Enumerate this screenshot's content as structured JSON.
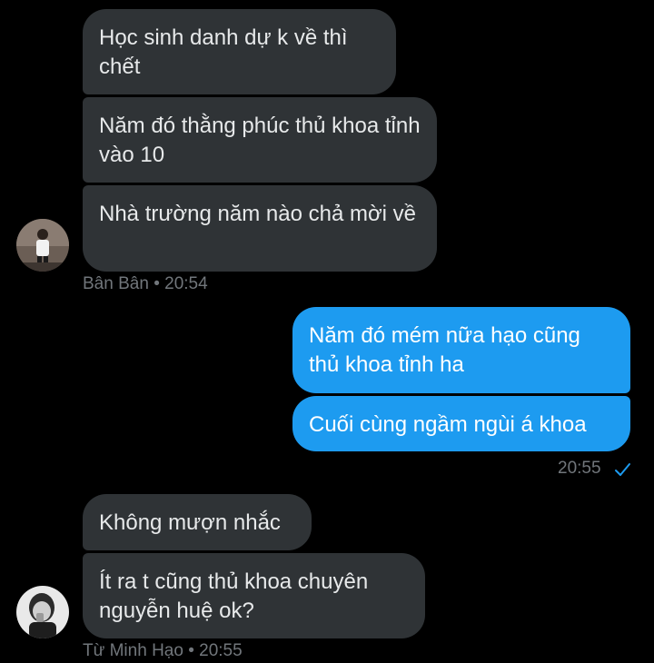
{
  "conversation": {
    "group1": {
      "messages": [
        "Học sinh danh dự k về thì chết",
        "Năm đó thằng phúc thủ khoa tỉnh vào 10",
        "Nhà trường năm nào chả mời về"
      ],
      "sender": "Bân Bân",
      "time": "20:54",
      "avatar_icon": "person-avatar-icon"
    },
    "group2": {
      "messages": [
        "Năm đó mém nữa hạo cũng thủ khoa tỉnh ha",
        "Cuối cùng ngầm ngùi á khoa"
      ],
      "time": "20:55",
      "status_icon": "check-icon"
    },
    "group3": {
      "messages": [
        "Không mượn nhắc",
        "Ít ra t cũng thủ khoa chuyên nguyễn huệ ok?"
      ],
      "sender": "Từ Minh Hạo",
      "time": "20:55",
      "avatar_icon": "person-avatar-icon"
    },
    "separator": "•"
  },
  "colors": {
    "background": "#000000",
    "incoming_bubble": "#2f3336",
    "outgoing_bubble": "#1d9bf0",
    "meta_text": "#71767b"
  }
}
